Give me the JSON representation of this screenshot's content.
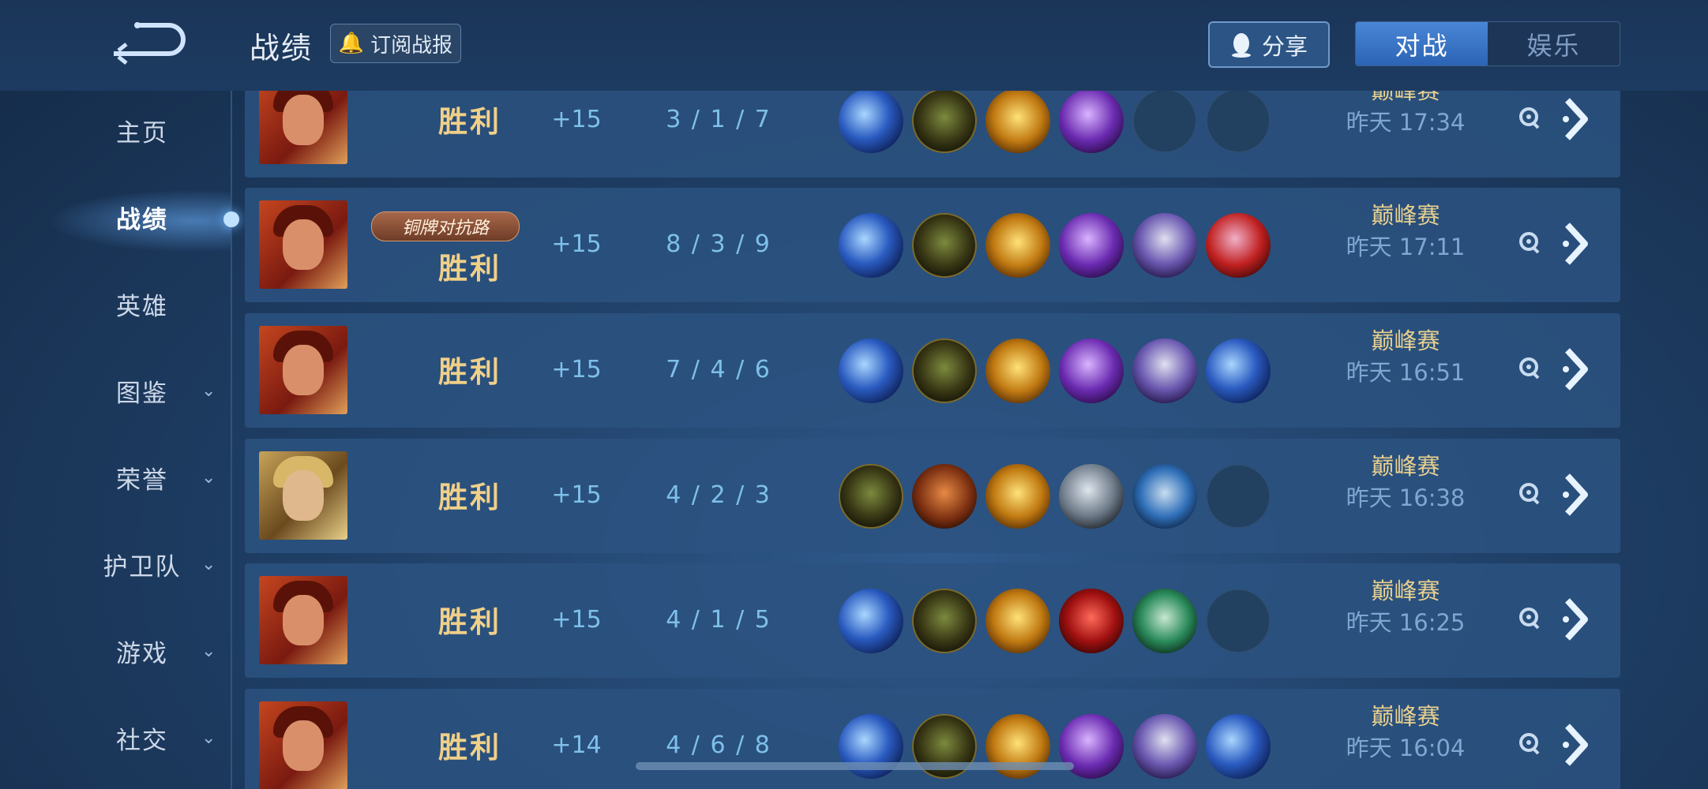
{
  "header": {
    "title": "战绩",
    "subscribe_label": "订阅战报",
    "share_label": "分享",
    "tabs": [
      {
        "label": "对战",
        "active": true
      },
      {
        "label": "娱乐",
        "active": false
      }
    ]
  },
  "sidebar": {
    "items": [
      {
        "label": "主页",
        "chevron": false
      },
      {
        "label": "战绩",
        "chevron": false,
        "active": true
      },
      {
        "label": "英雄",
        "chevron": false
      },
      {
        "label": "图鉴",
        "chevron": true
      },
      {
        "label": "荣誉",
        "chevron": true
      },
      {
        "label": "护卫队",
        "chevron": true
      },
      {
        "label": "游戏",
        "chevron": true
      },
      {
        "label": "社交",
        "chevron": true
      }
    ],
    "chevron_glyph": "⌄"
  },
  "matches": [
    {
      "result": "胜利",
      "points": "+15",
      "kda": "3 / 1 / 7",
      "mode": "巅峰赛",
      "time": "昨天 17:34",
      "badge": "",
      "hero": "a",
      "items": [
        "blue",
        "boot",
        "gold",
        "purple",
        "empty",
        "empty"
      ]
    },
    {
      "result": "胜利",
      "points": "+15",
      "kda": "8 / 3 / 9",
      "mode": "巅峰赛",
      "time": "昨天 17:11",
      "badge": "铜牌对抗路",
      "hero": "a",
      "items": [
        "blue",
        "boot",
        "gold",
        "purple",
        "armor",
        "red"
      ]
    },
    {
      "result": "胜利",
      "points": "+15",
      "kda": "7 / 4 / 6",
      "mode": "巅峰赛",
      "time": "昨天 16:51",
      "badge": "",
      "hero": "a",
      "items": [
        "blue",
        "boot",
        "gold",
        "purple",
        "armor",
        "blue"
      ]
    },
    {
      "result": "胜利",
      "points": "+15",
      "kda": "4 / 2 / 3",
      "mode": "巅峰赛",
      "time": "昨天 16:38",
      "badge": "",
      "hero": "b",
      "items": [
        "boot",
        "copper",
        "gold",
        "steel",
        "mask",
        "empty"
      ]
    },
    {
      "result": "胜利",
      "points": "+15",
      "kda": "4 / 1 / 5",
      "mode": "巅峰赛",
      "time": "昨天 16:25",
      "badge": "",
      "hero": "a",
      "items": [
        "blue",
        "boot",
        "gold",
        "ruby",
        "green",
        "empty"
      ]
    },
    {
      "result": "胜利",
      "points": "+14",
      "kda": "4 / 6 / 8",
      "mode": "巅峰赛",
      "time": "昨天 16:04",
      "badge": "",
      "hero": "a",
      "items": [
        "blue",
        "boot",
        "gold",
        "purple",
        "armor",
        "blue"
      ]
    }
  ],
  "icons": {
    "back": "back-arrow-icon",
    "replay": "replay-icon",
    "detail": "chevron-right-icon",
    "share": "qq-penguin-icon",
    "subscribe": "bell-icon"
  },
  "colors": {
    "win": "#f0d088",
    "kda": "#7ec0ea",
    "accent": "#3b78c9"
  }
}
